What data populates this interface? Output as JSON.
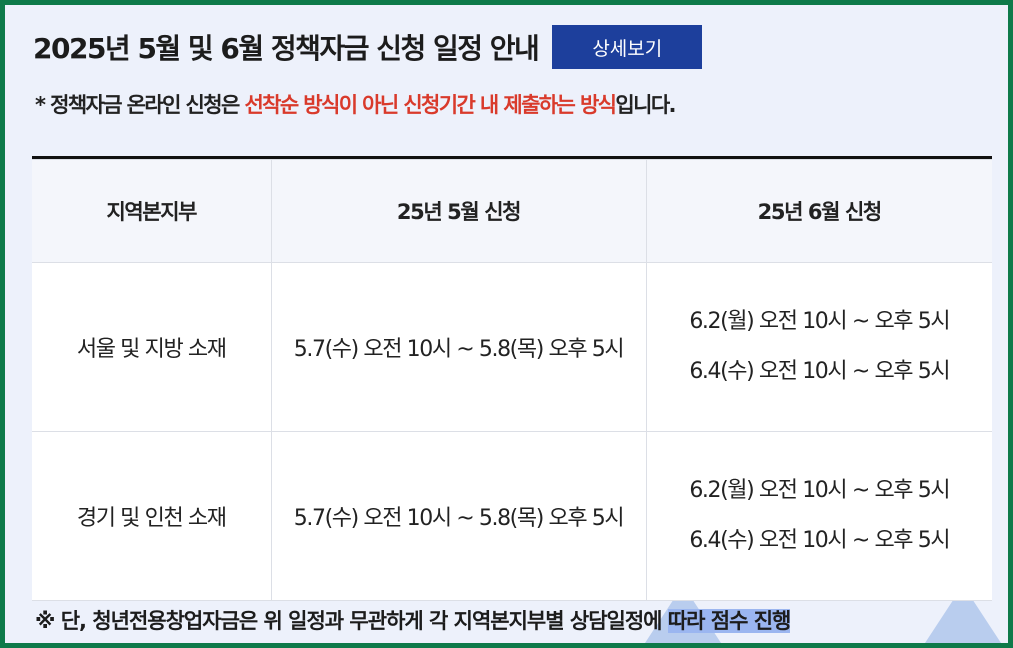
{
  "header": {
    "title": "2025년 5월 및 6월 정책자금 신청 일정 안내",
    "detail_button": "상세보기"
  },
  "notice": {
    "prefix": "* 정책자금 온라인 신청은 ",
    "emphasis": "선착순 방식이 아닌 신청기간 내 제출하는 방식",
    "suffix": "입니다.",
    "emphasis_color": "#d93a2b"
  },
  "table": {
    "headers": [
      "지역본지부",
      "25년 5월 신청",
      "25년 6월 신청"
    ],
    "rows": [
      {
        "region": "서울 및 지방 소재",
        "may": "5.7(수) 오전 10시 ~ 5.8(목) 오후 5시",
        "june": [
          "6.2(월) 오전 10시 ~ 오후 5시",
          "6.4(수) 오전 10시 ~ 오후 5시"
        ]
      },
      {
        "region": "경기 및 인천 소재",
        "may": "5.7(수) 오전 10시 ~ 5.8(목) 오후 5시",
        "june": [
          "6.2(월) 오전 10시 ~ 오후 5시",
          "6.4(수) 오전 10시 ~ 오후 5시"
        ]
      }
    ]
  },
  "footnote": {
    "text": "※ 단, 청년전용창업자금은 위 일정과 무관하게 각 지역본지부별 상담일정에 ",
    "highlight": "따라 점수 진행"
  },
  "colors": {
    "frame_border": "#0e7a4a",
    "button_bg": "#1d3f9c",
    "background": "#edf1fb"
  }
}
